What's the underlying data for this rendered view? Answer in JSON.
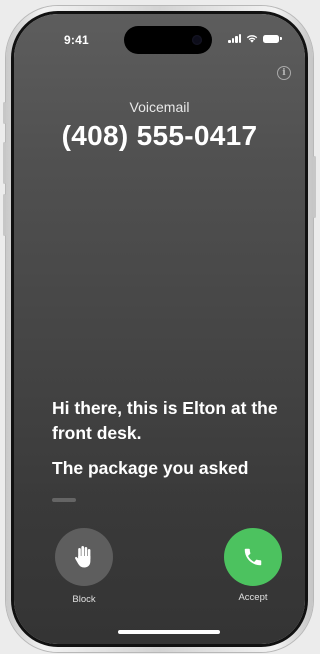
{
  "status_bar": {
    "time": "9:41"
  },
  "caller": {
    "label": "Voicemail",
    "number": "(408) 555-0417"
  },
  "transcript": {
    "lines": [
      "Hi there, this is Elton at the front desk.",
      "The package you asked"
    ]
  },
  "actions": {
    "block_label": "Block",
    "accept_label": "Accept"
  },
  "colors": {
    "accept": "#4cc25f",
    "block": "#5e5e5e"
  }
}
